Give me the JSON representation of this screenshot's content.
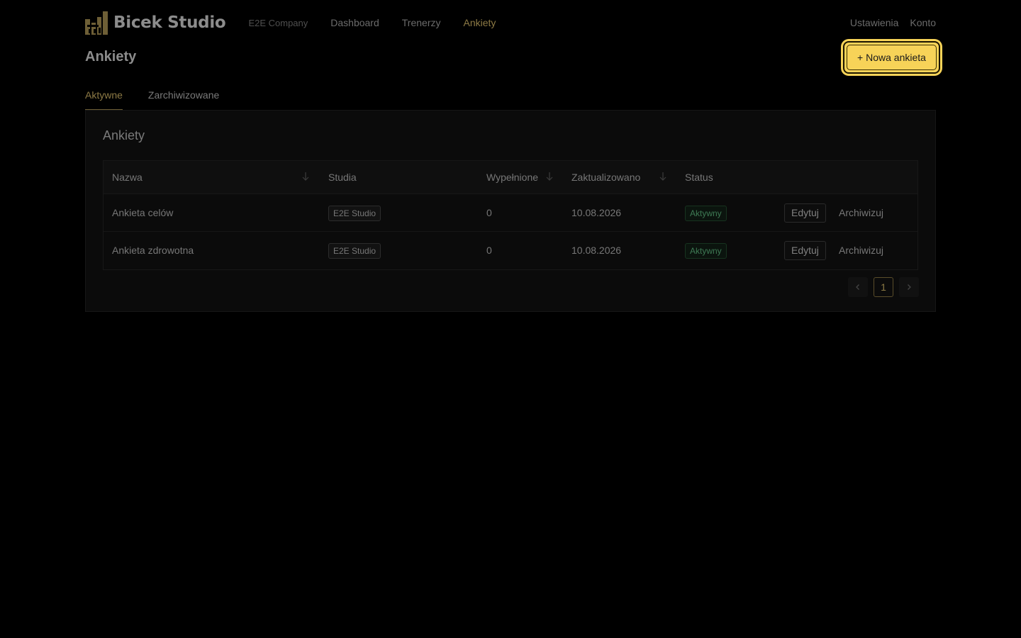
{
  "brand": {
    "name": "Bicek Studio",
    "company": "E2E Company"
  },
  "nav": {
    "items": [
      {
        "label": "Dashboard",
        "active": false
      },
      {
        "label": "Trenerzy",
        "active": false
      },
      {
        "label": "Ankiety",
        "active": true
      }
    ]
  },
  "topbar_right": {
    "settings": "Ustawienia",
    "account": "Konto"
  },
  "page": {
    "title": "Ankiety",
    "new_button": "+ Nowa ankieta"
  },
  "tabs": [
    {
      "label": "Aktywne",
      "active": true
    },
    {
      "label": "Zarchiwizowane",
      "active": false
    }
  ],
  "card": {
    "title": "Ankiety"
  },
  "table": {
    "columns": {
      "name": "Nazwa",
      "studios": "Studia",
      "filled": "Wypełnione",
      "updated": "Zaktualizowano",
      "status": "Status"
    },
    "rows": [
      {
        "name": "Ankieta celów",
        "studio": "E2E Studio",
        "filled": "0",
        "updated": "10.08.2026",
        "status": "Aktywny",
        "edit": "Edytuj",
        "archive": "Archiwizuj"
      },
      {
        "name": "Ankieta zdrowotna",
        "studio": "E2E Studio",
        "filled": "0",
        "updated": "10.08.2026",
        "status": "Aktywny",
        "edit": "Edytuj",
        "archive": "Archiwizuj"
      }
    ]
  },
  "pagination": {
    "current_page": "1",
    "prev_icon": "chevron-left-icon",
    "next_icon": "chevron-right-icon"
  },
  "colors": {
    "accent": "#8d7a45",
    "primary_button": "#f7d358",
    "status_active": "#3e7a54",
    "background": "#000000"
  }
}
